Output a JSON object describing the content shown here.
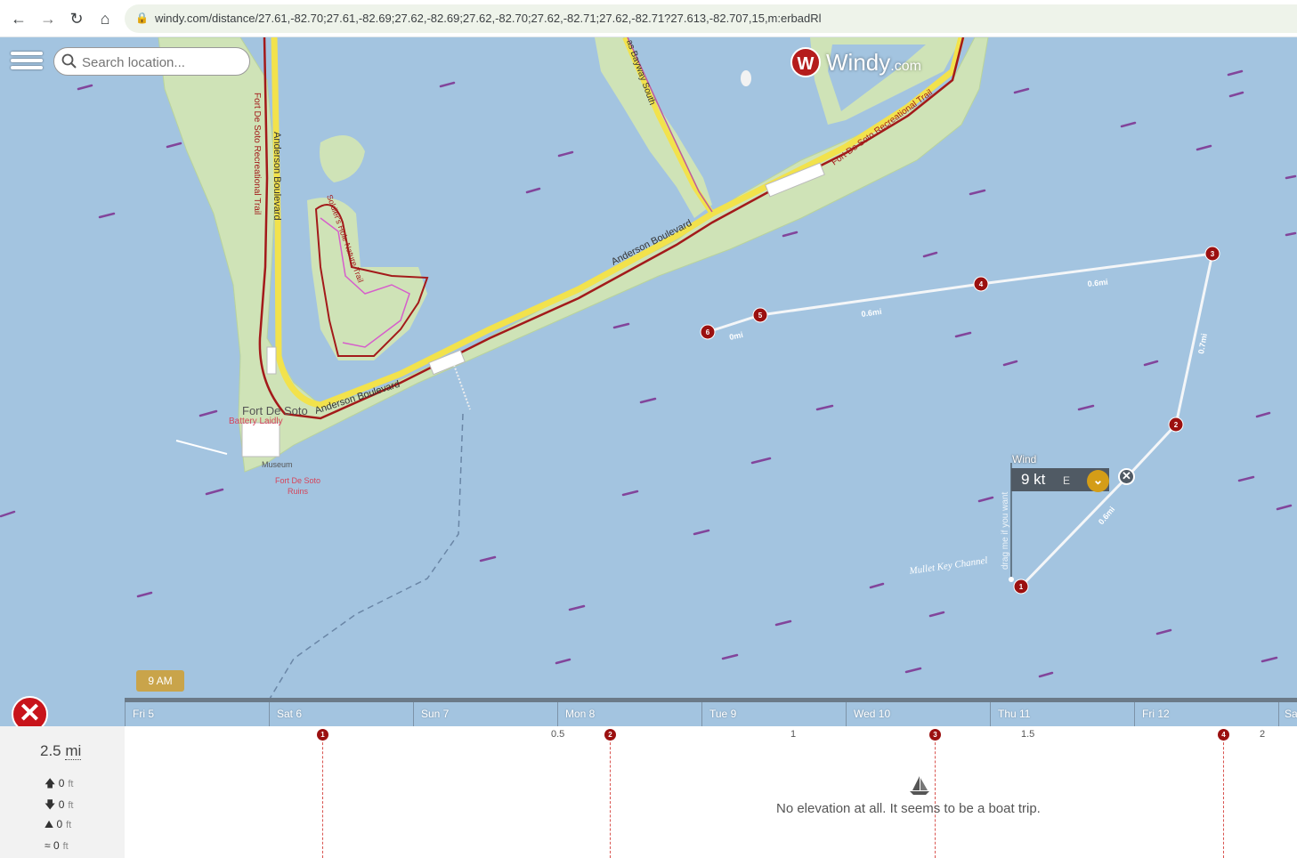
{
  "browser": {
    "url": "windy.com/distance/27.61,-82.70;27.61,-82.69;27.62,-82.69;27.62,-82.70;27.62,-82.71;27.62,-82.71?27.613,-82.707,15,m:erbadRl",
    "back_icon": "←",
    "forward_icon": "→",
    "reload_icon": "↻",
    "home_icon": "⌂",
    "lock_icon": "🔒"
  },
  "search": {
    "placeholder": "Search location..."
  },
  "logo": {
    "name": "Windy",
    "suffix": ".com",
    "mark": "W"
  },
  "map": {
    "labels": {
      "fort_de_soto": "Fort De Soto",
      "battery_laidly": "Battery Laidly",
      "museum": "Museum",
      "ruins_1": "Fort De Soto",
      "ruins_2": "Ruins",
      "anderson_blvd_1": "Anderson Boulevard",
      "anderson_blvd_2": "Anderson Boulevard",
      "anderson_blvd_3": "Anderson Boulevard",
      "rec_trail_1": "Fort De Soto Recreational Trail",
      "rec_trail_2": "Fort De Soto Recreational Trail",
      "nature_trail": "Soldier's Hole Nature Trail",
      "bayway": "as Bayway South",
      "channel": "Mullet Key Channel"
    },
    "route_labels": [
      "0mi",
      "0.6mi",
      "0.6mi",
      "0.7mi",
      "0.6mi"
    ],
    "route_pins": [
      "6",
      "5",
      "4",
      "3",
      "2",
      "1"
    ]
  },
  "wind": {
    "label": "Wind",
    "value": "9 kt",
    "direction": "E",
    "toggle_icon": "⌄",
    "close_icon": "✕",
    "drag_hint": "drag me if you want"
  },
  "timeline": {
    "current_time": "9 AM",
    "days": [
      "Fri 5",
      "Sat 6",
      "Sun 7",
      "Mon 8",
      "Tue 9",
      "Wed 10",
      "Thu 11",
      "Fri 12",
      "Sa"
    ]
  },
  "close_icon": "✕",
  "stats": {
    "distance_value": "2.5",
    "distance_unit": "mi",
    "ascent": "0",
    "descent": "0",
    "max_elev": "0",
    "avg_elev": "0",
    "unit": "ft",
    "ascent_icon": "🡅",
    "descent_icon": "🡇",
    "max_icon": "⛰",
    "avg_icon": "≈"
  },
  "elevation": {
    "ticks": [
      "0.5",
      "1",
      "1.5",
      "2"
    ],
    "pins": [
      "1",
      "2",
      "3",
      "4"
    ],
    "message": "No elevation at all. It seems to be a boat trip."
  }
}
